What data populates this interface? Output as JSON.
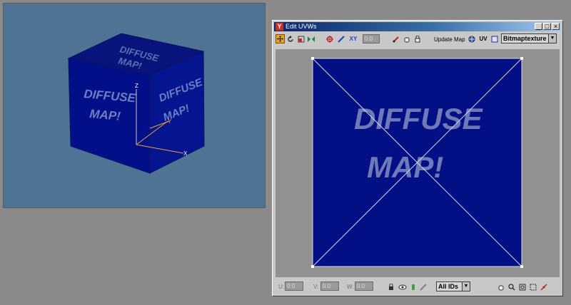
{
  "viewport": {
    "cube_texture": {
      "line1": "DIFFUSE",
      "line2": "MAP!"
    },
    "gizmo_axes": {
      "z": "Z",
      "x": "X",
      "y": "Y"
    }
  },
  "uvw_window": {
    "title": "Edit UVWs",
    "title_buttons": {
      "minimize": "_",
      "maximize": "□",
      "close": "×"
    },
    "toolbar": {
      "move_icon": "move-icon",
      "spinner_value": "0.0",
      "update_map_label": "Update Map",
      "uv_label": "UV",
      "texture_dropdown": "Bitmaptexture"
    },
    "canvas": {
      "texture_text": {
        "line1": "DIFFUSE",
        "line2": "MAP!"
      }
    },
    "bottom": {
      "u_label": "U:",
      "u_value": "0.0",
      "v_label": "V:",
      "v_value": "0.0",
      "w_label": "W:",
      "w_value": "0.0",
      "ids_dropdown": "All IDs"
    }
  },
  "colors": {
    "viewport_bg": "#4e7394",
    "cube_face": "#000e7a",
    "texture_bg": "#020f85",
    "window_bg": "#c8c8c8",
    "canvas_bg": "#919191"
  }
}
